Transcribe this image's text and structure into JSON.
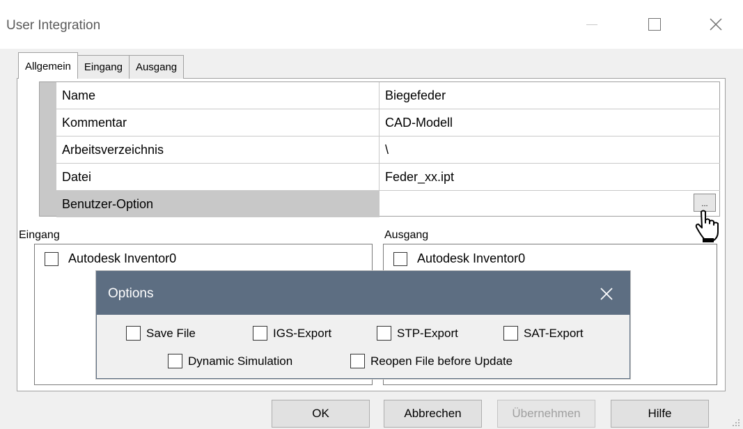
{
  "window": {
    "title": "User Integration"
  },
  "tabs": [
    {
      "label": "Allgemein",
      "active": true
    },
    {
      "label": "Eingang",
      "active": false
    },
    {
      "label": "Ausgang",
      "active": false
    }
  ],
  "properties": [
    {
      "name": "Name",
      "value": "Biegefeder"
    },
    {
      "name": "Kommentar",
      "value": "CAD-Modell"
    },
    {
      "name": "Arbeitsverzeichnis",
      "value": "\\"
    },
    {
      "name": "Datei",
      "value": "Feder_xx.ipt"
    },
    {
      "name": "Benutzer-Option",
      "value": ""
    }
  ],
  "ellipsis_label": "...",
  "input_group": {
    "label": "Eingang",
    "items": [
      {
        "label": "Autodesk Inventor0",
        "checked": false
      }
    ]
  },
  "output_group": {
    "label": "Ausgang",
    "items": [
      {
        "label": "Autodesk Inventor0",
        "checked": false
      }
    ]
  },
  "options_dialog": {
    "title": "Options",
    "checkboxes": [
      {
        "label": "Save File",
        "checked": false
      },
      {
        "label": "IGS-Export",
        "checked": false
      },
      {
        "label": "STP-Export",
        "checked": false
      },
      {
        "label": "SAT-Export",
        "checked": false
      },
      {
        "label": "Dynamic Simulation",
        "checked": false
      },
      {
        "label": "Reopen File before Update",
        "checked": false
      }
    ]
  },
  "buttons": {
    "ok": "OK",
    "cancel": "Abbrechen",
    "apply": "Übernehmen",
    "help": "Hilfe"
  },
  "colors": {
    "options_header": "#5d6e82",
    "selected_row": "#c8c8c8"
  }
}
